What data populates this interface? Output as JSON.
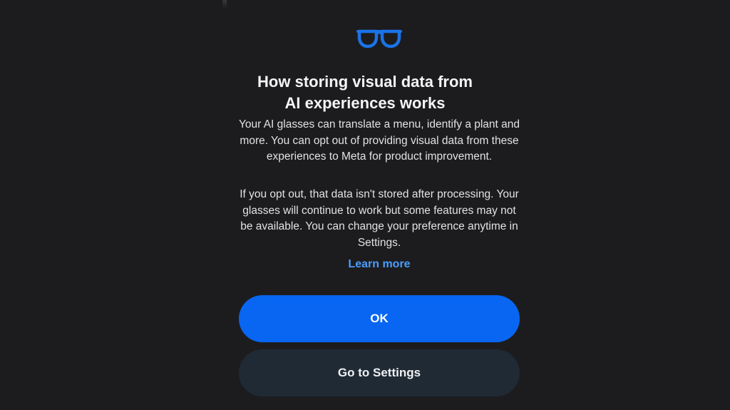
{
  "dialog": {
    "icon": "glasses-icon",
    "title_line1": "How storing visual data from",
    "title_line2": "AI experiences works",
    "paragraph1": "Your AI glasses can translate a menu, identify a plant and more. You can opt out of providing visual data from these experiences to Meta for product improvement.",
    "paragraph2": "If you opt out, that data isn't stored after processing. Your glasses will continue to work but some features may not be available. You can change your preference anytime in Settings.",
    "learn_more_label": "Learn more",
    "ok_label": "OK",
    "settings_label": "Go to Settings"
  },
  "colors": {
    "background": "#1c1c1e",
    "accent": "#0866f2",
    "link": "#4a9eff",
    "secondary_button": "#1f2a35",
    "icon": "#1a73e8"
  }
}
